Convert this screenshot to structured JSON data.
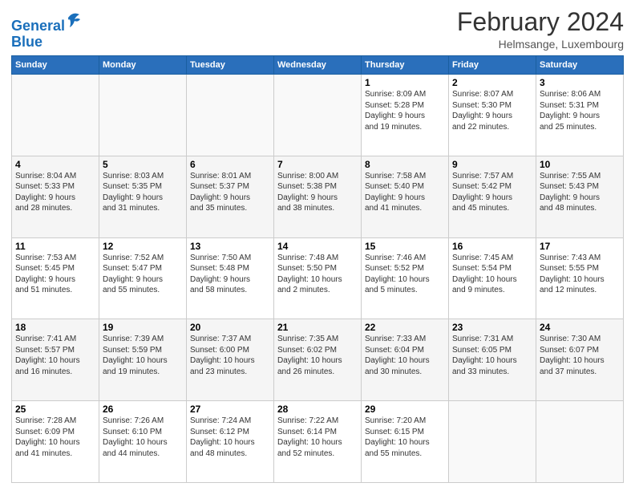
{
  "logo": {
    "line1": "General",
    "line2": "Blue"
  },
  "title": "February 2024",
  "subtitle": "Helmsange, Luxembourg",
  "weekdays": [
    "Sunday",
    "Monday",
    "Tuesday",
    "Wednesday",
    "Thursday",
    "Friday",
    "Saturday"
  ],
  "weeks": [
    [
      {
        "day": "",
        "info": ""
      },
      {
        "day": "",
        "info": ""
      },
      {
        "day": "",
        "info": ""
      },
      {
        "day": "",
        "info": ""
      },
      {
        "day": "1",
        "info": "Sunrise: 8:09 AM\nSunset: 5:28 PM\nDaylight: 9 hours\nand 19 minutes."
      },
      {
        "day": "2",
        "info": "Sunrise: 8:07 AM\nSunset: 5:30 PM\nDaylight: 9 hours\nand 22 minutes."
      },
      {
        "day": "3",
        "info": "Sunrise: 8:06 AM\nSunset: 5:31 PM\nDaylight: 9 hours\nand 25 minutes."
      }
    ],
    [
      {
        "day": "4",
        "info": "Sunrise: 8:04 AM\nSunset: 5:33 PM\nDaylight: 9 hours\nand 28 minutes."
      },
      {
        "day": "5",
        "info": "Sunrise: 8:03 AM\nSunset: 5:35 PM\nDaylight: 9 hours\nand 31 minutes."
      },
      {
        "day": "6",
        "info": "Sunrise: 8:01 AM\nSunset: 5:37 PM\nDaylight: 9 hours\nand 35 minutes."
      },
      {
        "day": "7",
        "info": "Sunrise: 8:00 AM\nSunset: 5:38 PM\nDaylight: 9 hours\nand 38 minutes."
      },
      {
        "day": "8",
        "info": "Sunrise: 7:58 AM\nSunset: 5:40 PM\nDaylight: 9 hours\nand 41 minutes."
      },
      {
        "day": "9",
        "info": "Sunrise: 7:57 AM\nSunset: 5:42 PM\nDaylight: 9 hours\nand 45 minutes."
      },
      {
        "day": "10",
        "info": "Sunrise: 7:55 AM\nSunset: 5:43 PM\nDaylight: 9 hours\nand 48 minutes."
      }
    ],
    [
      {
        "day": "11",
        "info": "Sunrise: 7:53 AM\nSunset: 5:45 PM\nDaylight: 9 hours\nand 51 minutes."
      },
      {
        "day": "12",
        "info": "Sunrise: 7:52 AM\nSunset: 5:47 PM\nDaylight: 9 hours\nand 55 minutes."
      },
      {
        "day": "13",
        "info": "Sunrise: 7:50 AM\nSunset: 5:48 PM\nDaylight: 9 hours\nand 58 minutes."
      },
      {
        "day": "14",
        "info": "Sunrise: 7:48 AM\nSunset: 5:50 PM\nDaylight: 10 hours\nand 2 minutes."
      },
      {
        "day": "15",
        "info": "Sunrise: 7:46 AM\nSunset: 5:52 PM\nDaylight: 10 hours\nand 5 minutes."
      },
      {
        "day": "16",
        "info": "Sunrise: 7:45 AM\nSunset: 5:54 PM\nDaylight: 10 hours\nand 9 minutes."
      },
      {
        "day": "17",
        "info": "Sunrise: 7:43 AM\nSunset: 5:55 PM\nDaylight: 10 hours\nand 12 minutes."
      }
    ],
    [
      {
        "day": "18",
        "info": "Sunrise: 7:41 AM\nSunset: 5:57 PM\nDaylight: 10 hours\nand 16 minutes."
      },
      {
        "day": "19",
        "info": "Sunrise: 7:39 AM\nSunset: 5:59 PM\nDaylight: 10 hours\nand 19 minutes."
      },
      {
        "day": "20",
        "info": "Sunrise: 7:37 AM\nSunset: 6:00 PM\nDaylight: 10 hours\nand 23 minutes."
      },
      {
        "day": "21",
        "info": "Sunrise: 7:35 AM\nSunset: 6:02 PM\nDaylight: 10 hours\nand 26 minutes."
      },
      {
        "day": "22",
        "info": "Sunrise: 7:33 AM\nSunset: 6:04 PM\nDaylight: 10 hours\nand 30 minutes."
      },
      {
        "day": "23",
        "info": "Sunrise: 7:31 AM\nSunset: 6:05 PM\nDaylight: 10 hours\nand 33 minutes."
      },
      {
        "day": "24",
        "info": "Sunrise: 7:30 AM\nSunset: 6:07 PM\nDaylight: 10 hours\nand 37 minutes."
      }
    ],
    [
      {
        "day": "25",
        "info": "Sunrise: 7:28 AM\nSunset: 6:09 PM\nDaylight: 10 hours\nand 41 minutes."
      },
      {
        "day": "26",
        "info": "Sunrise: 7:26 AM\nSunset: 6:10 PM\nDaylight: 10 hours\nand 44 minutes."
      },
      {
        "day": "27",
        "info": "Sunrise: 7:24 AM\nSunset: 6:12 PM\nDaylight: 10 hours\nand 48 minutes."
      },
      {
        "day": "28",
        "info": "Sunrise: 7:22 AM\nSunset: 6:14 PM\nDaylight: 10 hours\nand 52 minutes."
      },
      {
        "day": "29",
        "info": "Sunrise: 7:20 AM\nSunset: 6:15 PM\nDaylight: 10 hours\nand 55 minutes."
      },
      {
        "day": "",
        "info": ""
      },
      {
        "day": "",
        "info": ""
      }
    ]
  ]
}
